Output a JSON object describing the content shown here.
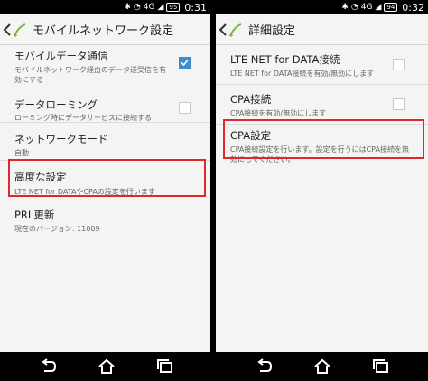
{
  "status": {
    "left_time": "0:31",
    "left_battery": "95",
    "right_time": "0:32",
    "right_battery": "94",
    "network": "4G"
  },
  "left": {
    "title": "モバイルネットワーク設定",
    "items": [
      {
        "title": "モバイルデータ通信",
        "sub1": "モバイルネットワーク経由のデータ送受信を有",
        "sub2": "効にする",
        "checked": true
      },
      {
        "title": "データローミング",
        "sub1": "ローミング時にデータサービスに接続する",
        "checked": false
      },
      {
        "title": "ネットワークモード",
        "sub1": "自動"
      },
      {
        "title": "高度な設定",
        "sub1": "LTE NET for DATAやCPAの設定を行います"
      },
      {
        "title": "PRL更新",
        "sub1": "現在のバージョン: 11009"
      }
    ]
  },
  "right": {
    "title": "詳細設定",
    "items": [
      {
        "title": "LTE NET for DATA接続",
        "sub1": "LTE NET for DATA接続を有効/無効にします",
        "checked": false
      },
      {
        "title": "CPA接続",
        "sub1": "CPA接続を有効/無効にします",
        "checked": false
      },
      {
        "title": "CPA設定",
        "sub1": "CPA接続設定を行います。設定を行うにはCPA接続を無",
        "sub2": "効にしてください。"
      }
    ]
  },
  "icons": {
    "back": "back-chevron-icon",
    "logo": "app-logo-icon",
    "nav_back": "nav-back-icon",
    "nav_home": "nav-home-icon",
    "nav_recents": "nav-recents-icon"
  },
  "colors": {
    "highlight": "#e0272b",
    "checkbox": "#3d8fc7",
    "logo_green": "#7cb342"
  }
}
